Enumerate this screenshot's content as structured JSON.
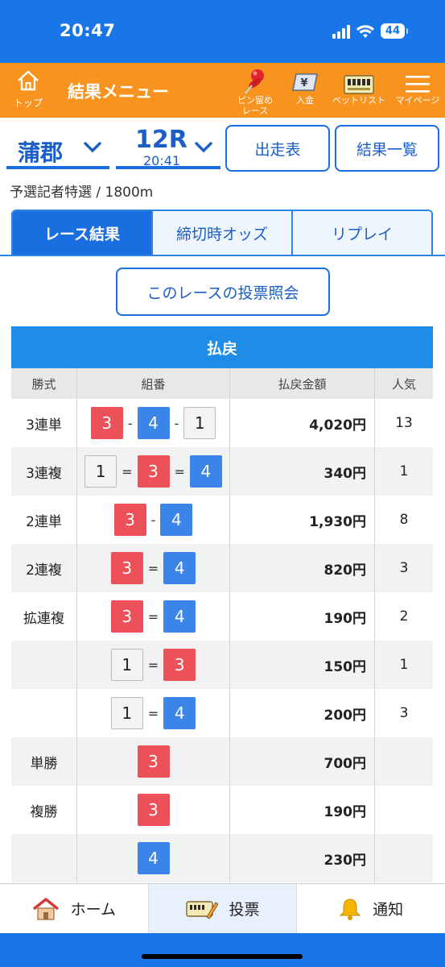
{
  "status": {
    "time": "20:47",
    "battery": "44"
  },
  "header": {
    "home_label": "トップ",
    "title": "結果メニュー",
    "pin_label": "ピン留め\nレース",
    "deposit_label": "入金",
    "betlist_label": "ベットリスト",
    "mypage_label": "マイページ",
    "colors": {
      "status_bar": "#1976e8",
      "header": "#f7931e",
      "accent": "#1a6fe0"
    }
  },
  "race": {
    "venue": "蒲郡",
    "race_no": "12R",
    "race_time": "20:41",
    "entry_button": "出走表",
    "results_button": "結果一覧",
    "race_name": "予選記者特選",
    "distance_sep": " / ",
    "distance": "1800m"
  },
  "tabs": [
    {
      "label": "レース結果",
      "active": true
    },
    {
      "label": "締切時オッズ",
      "active": false
    },
    {
      "label": "リプレイ",
      "active": false
    }
  ],
  "vote_button": "このレースの投票照会",
  "payout": {
    "title": "払戻",
    "headers": [
      "勝式",
      "組番",
      "払戻金額",
      "人気"
    ],
    "rows": [
      {
        "type": "3連単",
        "combo": [
          {
            "n": "3",
            "c": "r"
          },
          {
            "s": "-"
          },
          {
            "n": "4",
            "c": "b"
          },
          {
            "s": "-"
          },
          {
            "n": "1",
            "c": "w"
          }
        ],
        "amount": "4,020円",
        "pop": "13"
      },
      {
        "type": "3連複",
        "combo": [
          {
            "n": "1",
            "c": "w"
          },
          {
            "s": "="
          },
          {
            "n": "3",
            "c": "r"
          },
          {
            "s": "="
          },
          {
            "n": "4",
            "c": "b"
          }
        ],
        "amount": "340円",
        "pop": "1"
      },
      {
        "type": "2連単",
        "combo": [
          {
            "n": "3",
            "c": "r"
          },
          {
            "s": "-"
          },
          {
            "n": "4",
            "c": "b"
          }
        ],
        "amount": "1,930円",
        "pop": "8"
      },
      {
        "type": "2連複",
        "combo": [
          {
            "n": "3",
            "c": "r"
          },
          {
            "s": "="
          },
          {
            "n": "4",
            "c": "b"
          }
        ],
        "amount": "820円",
        "pop": "3"
      },
      {
        "type": "拡連複",
        "combo": [
          {
            "n": "3",
            "c": "r"
          },
          {
            "s": "="
          },
          {
            "n": "4",
            "c": "b"
          }
        ],
        "amount": "190円",
        "pop": "2"
      },
      {
        "type": "",
        "combo": [
          {
            "n": "1",
            "c": "w"
          },
          {
            "s": "="
          },
          {
            "n": "3",
            "c": "r"
          }
        ],
        "amount": "150円",
        "pop": "1"
      },
      {
        "type": "",
        "combo": [
          {
            "n": "1",
            "c": "w"
          },
          {
            "s": "="
          },
          {
            "n": "4",
            "c": "b"
          }
        ],
        "amount": "200円",
        "pop": "3"
      },
      {
        "type": "単勝",
        "combo": [
          {
            "n": "3",
            "c": "r"
          }
        ],
        "amount": "700円",
        "pop": ""
      },
      {
        "type": "複勝",
        "combo": [
          {
            "n": "3",
            "c": "r"
          }
        ],
        "amount": "190円",
        "pop": ""
      },
      {
        "type": "",
        "combo": [
          {
            "n": "4",
            "c": "b"
          }
        ],
        "amount": "230円",
        "pop": ""
      }
    ]
  },
  "bottom_nav": [
    {
      "label": "ホーム",
      "icon": "house-icon",
      "active": false
    },
    {
      "label": "投票",
      "icon": "vote-ticket-icon",
      "active": true
    },
    {
      "label": "通知",
      "icon": "bell-icon",
      "active": false
    }
  ]
}
